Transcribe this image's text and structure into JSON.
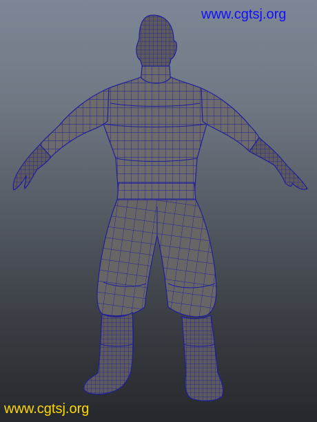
{
  "watermark_top": {
    "text": "www.cgtsj.org",
    "color": "#1010ff"
  },
  "watermark_bottom": {
    "text": "www.cgtsj.org",
    "color": "#ffd800"
  },
  "viewport": {
    "background_top": "#7d8795",
    "background_bottom": "#25282c",
    "mesh_fill": "#6c6a6a",
    "wire_color": "#1e1e9c",
    "subject": "character-wireframe-model"
  }
}
